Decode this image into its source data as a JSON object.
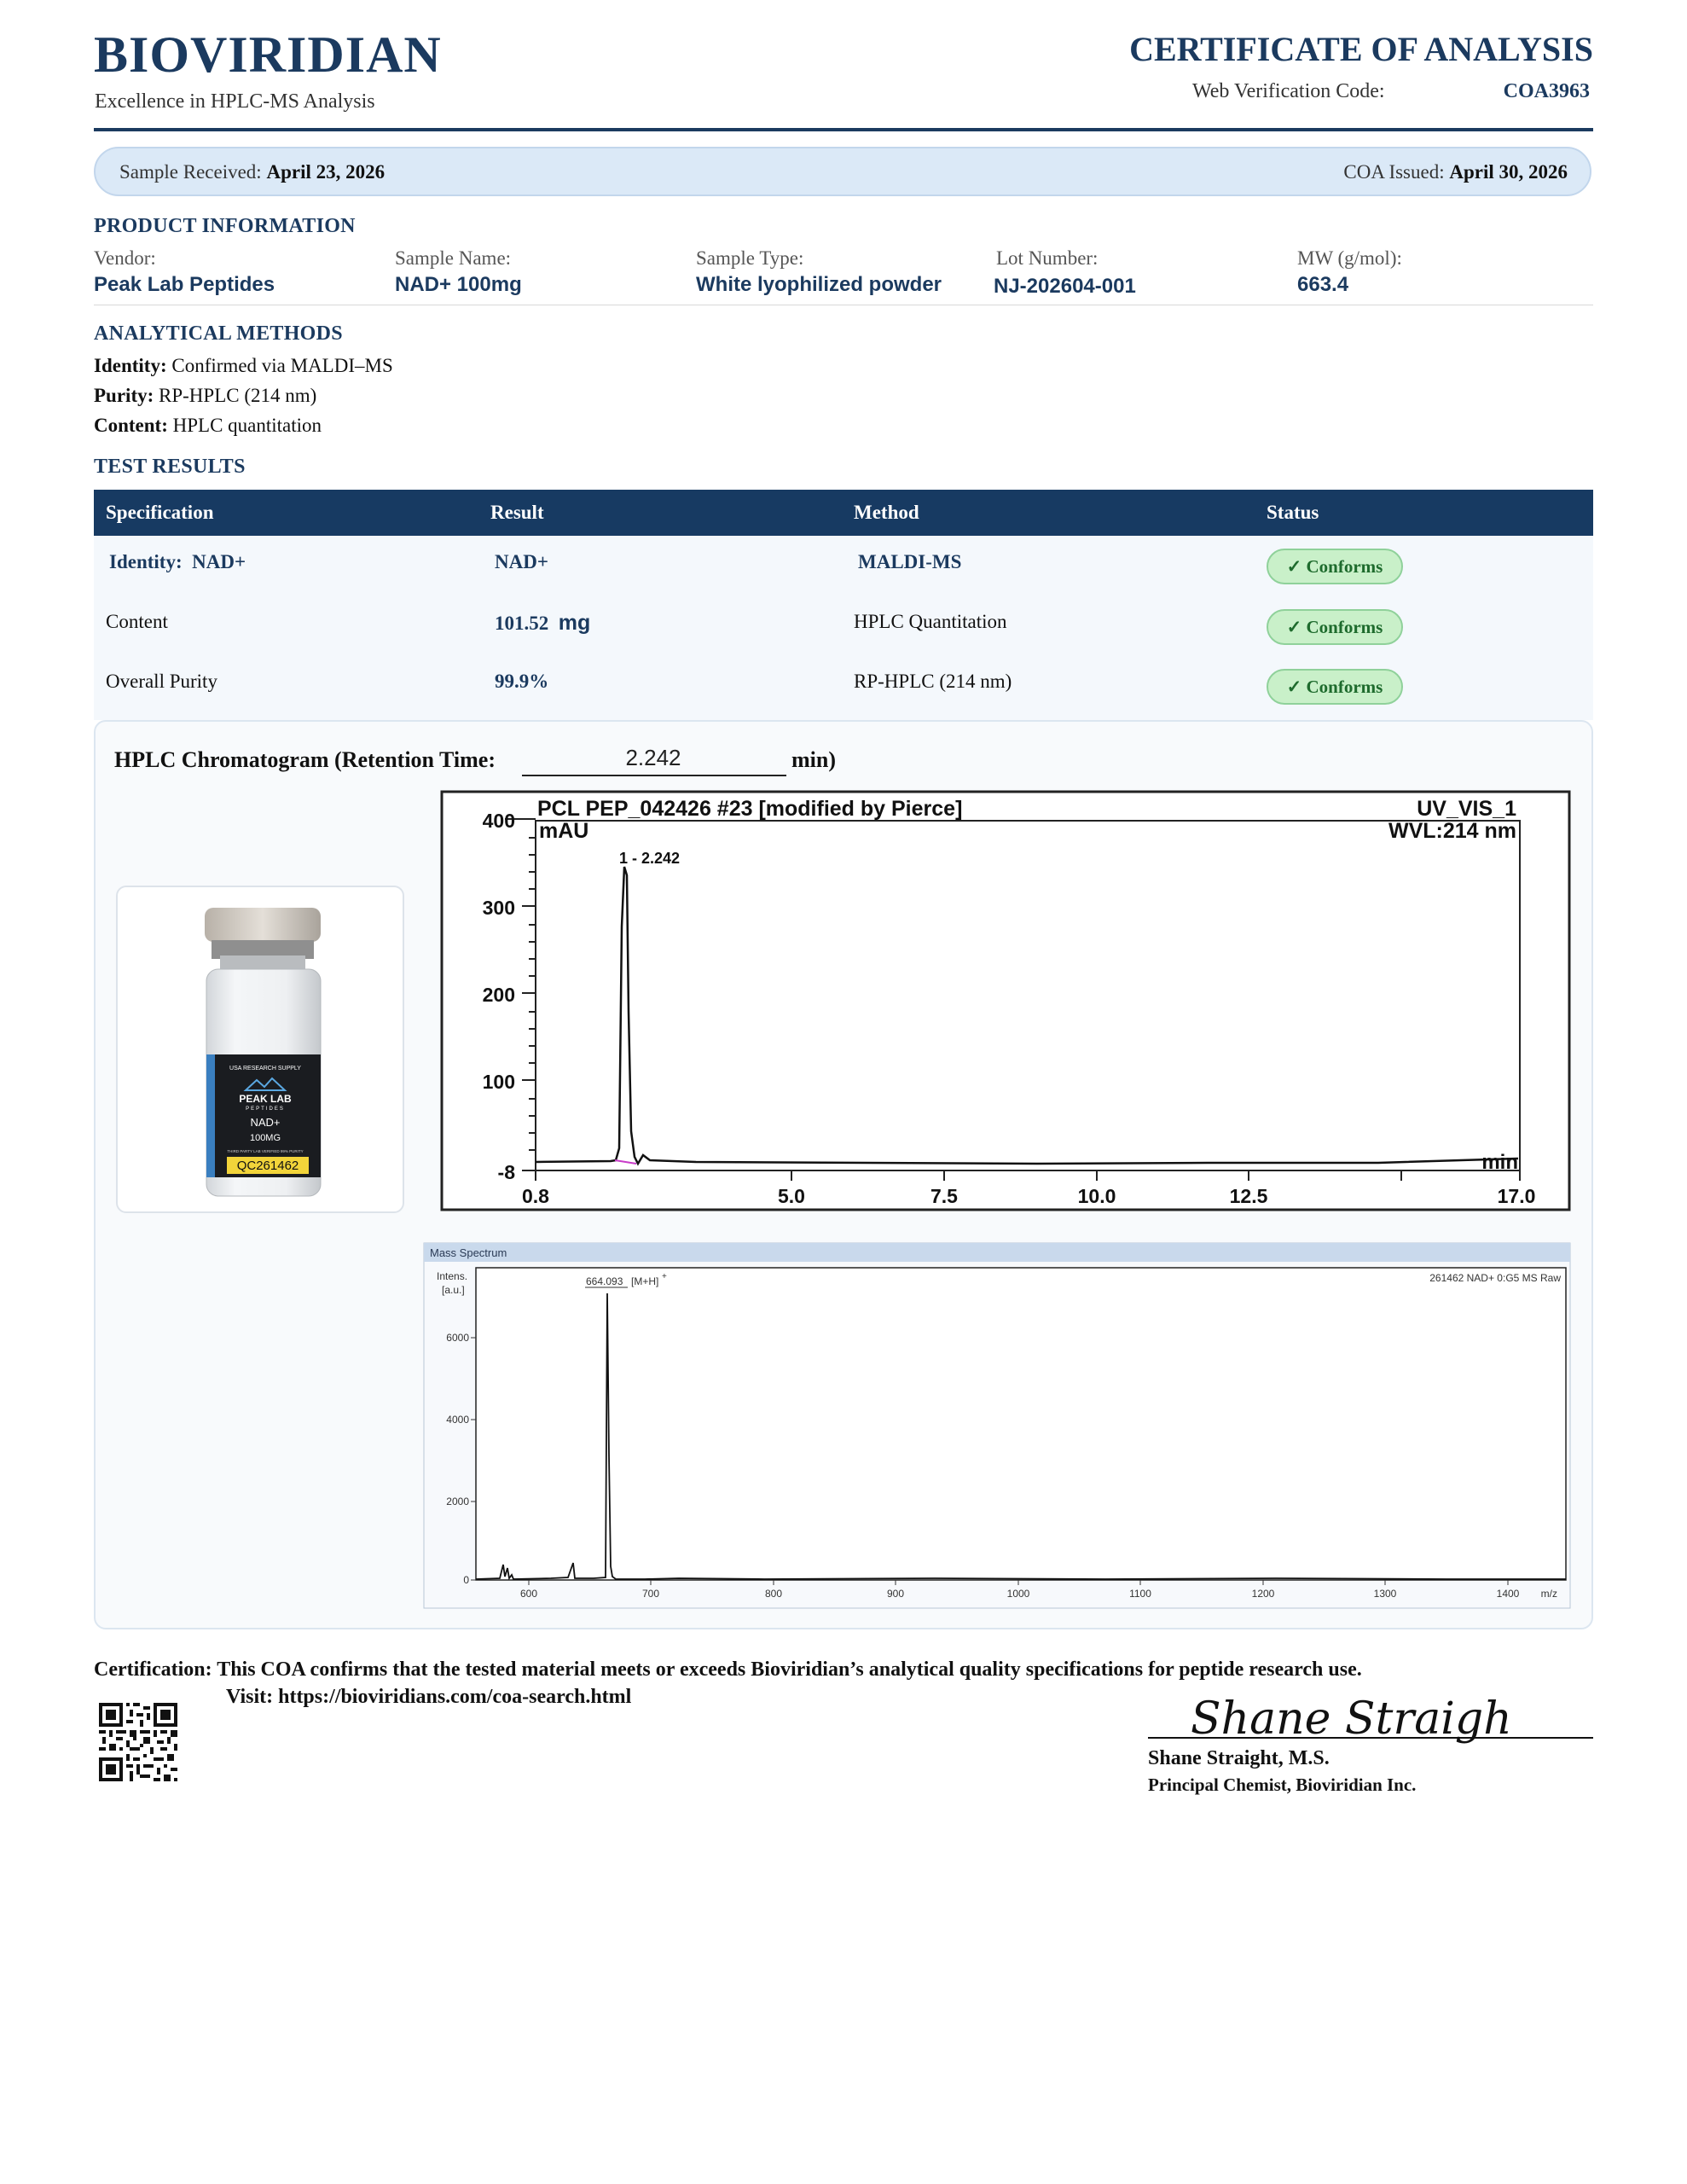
{
  "header": {
    "brand": "BIOVIRIDIAN",
    "tagline": "Excellence in HPLC-MS Analysis",
    "title": "CERTIFICATE OF ANALYSIS",
    "verification_label": "Web Verification Code:",
    "verification_code": "COA3963"
  },
  "dates": {
    "received_label": "Sample Received:",
    "received_value": "April 23, 2026",
    "issued_label": "COA Issued:",
    "issued_value": "April 30, 2026"
  },
  "product_info": {
    "heading": "PRODUCT INFORMATION",
    "fields": [
      {
        "label": "Vendor:",
        "value": "Peak Lab Peptides"
      },
      {
        "label": "Sample Name:",
        "value": "NAD+ 100mg"
      },
      {
        "label": "Sample Type:",
        "value": "White lyophilized powder"
      },
      {
        "label": "Lot Number:",
        "value": "NJ-202604-001"
      },
      {
        "label": "MW (g/mol):",
        "value": "663.4"
      }
    ]
  },
  "methods": {
    "heading": "ANALYTICAL METHODS",
    "items": [
      {
        "label": "Identity:",
        "value": "Confirmed via MALDI–MS"
      },
      {
        "label": "Purity:",
        "value": "RP-HPLC (214 nm)"
      },
      {
        "label": "Content:",
        "value": "HPLC quantitation"
      }
    ]
  },
  "results": {
    "heading": "TEST RESULTS",
    "columns": [
      "Specification",
      "Result",
      "Method",
      "Status"
    ],
    "rows": [
      {
        "spec_label": "Identity:",
        "spec_value": "NAD+",
        "result": "NAD+",
        "result_unit": "",
        "method": "MALDI-MS",
        "status": "✓ Conforms"
      },
      {
        "spec_label": "Content",
        "spec_value": "",
        "result": "101.52",
        "result_unit": "mg",
        "method": "HPLC Quantitation",
        "status": "✓ Conforms"
      },
      {
        "spec_label": "Overall Purity",
        "spec_value": "",
        "result": "99.9%",
        "result_unit": "",
        "method": "RP-HPLC (214 nm)",
        "status": "✓ Conforms"
      }
    ]
  },
  "chromatogram": {
    "title": "HPLC Chromatogram (Retention Time:",
    "retention_time": "2.242",
    "unit": "min)",
    "vial": {
      "brand_top": "USA RESEARCH SUPPLY",
      "brand": "PEAK LAB",
      "brand_sub": "PEPTIDES",
      "product": "NAD+",
      "dose": "100MG",
      "fine_print": "THIRD PARTY LAB VERIFIED 99% PURITY",
      "code": "QC261462"
    },
    "hplc": {
      "header_left": "PCL PEP_042426 #23 [modified by Pierce]",
      "header_right": "UV_VIS_1",
      "wavelength": "WVL:214 nm",
      "y_unit": "mAU",
      "x_unit": "min",
      "peak_label": "1 - 2.242",
      "y_ticks": [
        "400",
        "300",
        "200",
        "100",
        "-8"
      ],
      "x_ticks": [
        "0.8",
        "5.0",
        "7.5",
        "10.0",
        "12.5",
        "17.0"
      ]
    },
    "mass_spectrum": {
      "window_title": "Mass Spectrum",
      "y_label_1": "Intens.",
      "y_label_2": "[a.u.]",
      "file_label": "261462 NAD+ 0:G5 MS Raw",
      "peak_label": "664.093",
      "peak_ion": "[M+H]",
      "peak_charge": "+",
      "x_unit": "m/z",
      "y_ticks": [
        "6000",
        "4000",
        "2000",
        "0"
      ],
      "x_ticks": [
        "600",
        "700",
        "800",
        "900",
        "1000",
        "1100",
        "1200",
        "1300",
        "1400"
      ]
    }
  },
  "footer": {
    "certification_label": "Certification:",
    "certification_text": "This COA confirms that the tested material meets or exceeds Bioviridian’s analytical quality specifications for peptide research use.",
    "visit_text": "Visit: https://bioviridians.com/coa-search.html",
    "signature": "Shane Straight",
    "signer_name": "Shane Straight, M.S.",
    "signer_title": "Principal Chemist, Bioviridian Inc."
  }
}
